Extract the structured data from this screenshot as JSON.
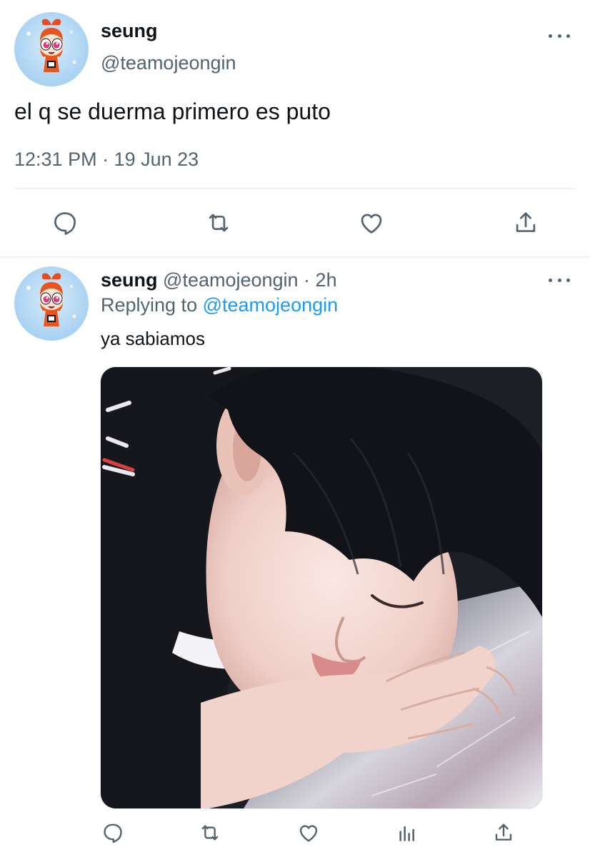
{
  "tweet": {
    "display_name": "seung",
    "handle": "@teamojeongin",
    "text": "el q se duerma primero es puto",
    "timestamp": "12:31 PM · 19 Jun 23",
    "actions": [
      "reply-icon",
      "retweet-icon",
      "like-icon",
      "share-icon"
    ]
  },
  "reply": {
    "display_name": "seung",
    "handle_time": "@teamojeongin · 2h",
    "replying_prefix": "Replying to",
    "replying_handle": "@teamojeongin",
    "text": "ya sabiamos",
    "actions": [
      "reply-icon",
      "retweet-icon",
      "like-icon",
      "analytics-icon",
      "share-icon"
    ]
  },
  "colors": {
    "text": "#0f1419",
    "muted": "#536471",
    "link": "#1d9bf0",
    "divider": "#eff3f4"
  }
}
